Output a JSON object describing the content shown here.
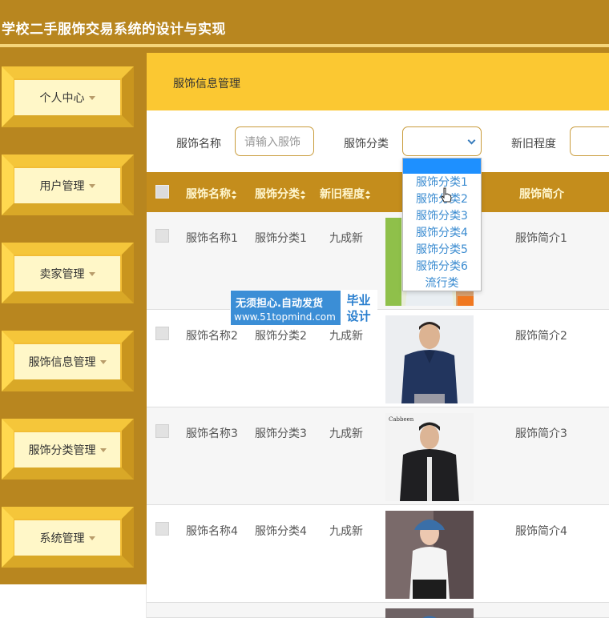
{
  "app": {
    "title": "学校二手服饰交易系统的设计与实现"
  },
  "sidebar": {
    "items": [
      {
        "label": "个人中心"
      },
      {
        "label": "用户管理"
      },
      {
        "label": "卖家管理"
      },
      {
        "label": "服饰信息管理"
      },
      {
        "label": "服饰分类管理"
      },
      {
        "label": "系统管理"
      }
    ]
  },
  "breadcrumb": {
    "current": "服饰信息管理"
  },
  "search": {
    "name_label": "服饰名称",
    "name_placeholder": "请输入服饰",
    "category_label": "服饰分类",
    "condition_label": "新旧程度"
  },
  "dropdown": {
    "options": [
      "服饰分类1",
      "服饰分类2",
      "服饰分类3",
      "服饰分类4",
      "服饰分类5",
      "服饰分类6",
      "流行类"
    ]
  },
  "table": {
    "headers": {
      "name": "服饰名称",
      "category": "服饰分类",
      "condition": "新旧程度",
      "intro": "服饰简介"
    },
    "rows": [
      {
        "name": "服饰名称1",
        "category": "服饰分类1",
        "condition": "九成新",
        "intro": "服饰简介1"
      },
      {
        "name": "服饰名称2",
        "category": "服饰分类2",
        "condition": "九成新",
        "intro": "服饰简介2"
      },
      {
        "name": "服饰名称3",
        "category": "服饰分类3",
        "condition": "九成新",
        "intro": "服饰简介3"
      },
      {
        "name": "服饰名称4",
        "category": "服饰分类4",
        "condition": "九成新",
        "intro": "服饰简介4"
      }
    ]
  },
  "watermark": {
    "line1": "无须担心.自动发货",
    "line2": "www.51topmind.com",
    "badge1": "毕业",
    "badge2": "设计"
  },
  "colors": {
    "header": "#b8861f",
    "accent": "#fbc832",
    "table_head": "#c48d1c",
    "link": "#3a8bd0"
  }
}
